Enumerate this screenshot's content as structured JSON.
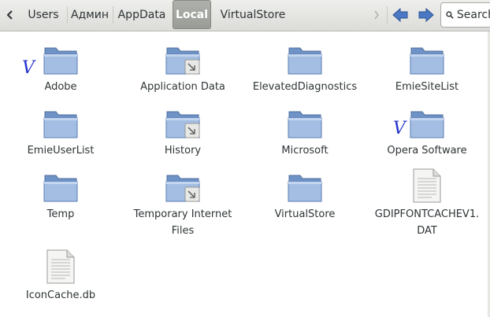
{
  "toolbar": {
    "back_icon": "chevron-left-icon",
    "breadcrumbs": [
      "Users",
      "Админ",
      "AppData",
      "Local",
      "VirtualStore"
    ],
    "active_crumb": "Local",
    "more_icon": "chevron-right-icon",
    "nav_back_icon": "arrow-left-icon",
    "nav_forward_icon": "arrow-right-icon",
    "search_label": "Search"
  },
  "items": [
    {
      "name": "Adobe",
      "type": "folder",
      "checked": true
    },
    {
      "name": "Application Data",
      "type": "folder-link"
    },
    {
      "name": "ElevatedDiagnostics",
      "type": "folder"
    },
    {
      "name": "EmieSiteList",
      "type": "folder"
    },
    {
      "name": "EmieUserList",
      "type": "folder"
    },
    {
      "name": "History",
      "type": "folder-link"
    },
    {
      "name": "Microsoft",
      "type": "folder"
    },
    {
      "name": "Opera Software",
      "type": "folder",
      "checked": true
    },
    {
      "name": "Temp",
      "type": "folder"
    },
    {
      "name": "Temporary Internet Files",
      "type": "folder-link"
    },
    {
      "name": "VirtualStore",
      "type": "folder"
    },
    {
      "name": "GDIPFONTCACHEV1.DAT",
      "type": "file"
    },
    {
      "name": "IconCache.db",
      "type": "file"
    }
  ],
  "annotations": {
    "check_mark": "V"
  },
  "colors": {
    "folder_body": "#6f93c6",
    "folder_front": "#a4bde2",
    "active_crumb_bg": "#a3a5a0",
    "annotation_ink": "#2233cc",
    "nav_arrow": "#3f6db8"
  }
}
